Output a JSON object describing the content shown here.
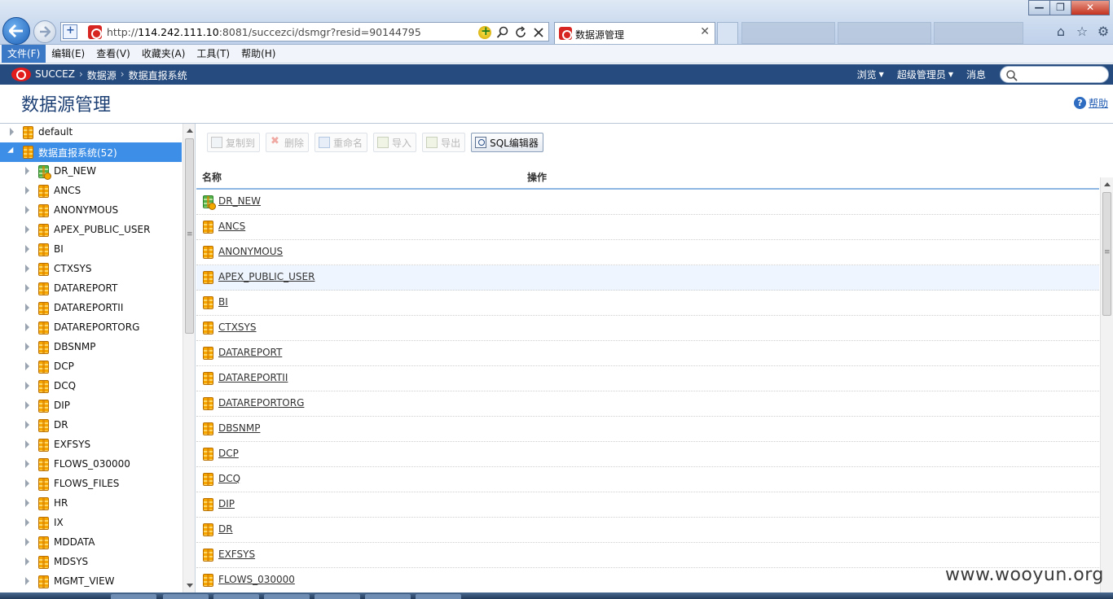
{
  "browser": {
    "url_prefix": "http://",
    "url_host": "114.242.111.10",
    "url_rest": ":8081/succezci/dsmgr?resid=90144795",
    "tab_title": "数据源管理",
    "tab_close": "✕",
    "window_controls": {
      "minimize": "—",
      "maximize": "❐",
      "close": "✕"
    }
  },
  "menubar": {
    "items": [
      {
        "label": "文件(F)"
      },
      {
        "label": "编辑(E)"
      },
      {
        "label": "查看(V)"
      },
      {
        "label": "收藏夹(A)"
      },
      {
        "label": "工具(T)"
      },
      {
        "label": "帮助(H)"
      }
    ]
  },
  "app_header": {
    "brand": "SUCCEZ",
    "crumb_1": "数据源",
    "crumb_2": "数据直报系统",
    "menu_browse": "浏览",
    "menu_admin": "超级管理员",
    "menu_messages": "消息",
    "search_placeholder": ""
  },
  "page": {
    "title": "数据源管理",
    "help_label": "帮助"
  },
  "tree": {
    "root": "default",
    "selected_group": "数据直报系统(52)",
    "children": [
      {
        "label": "DR_NEW",
        "icon": "green"
      },
      {
        "label": "ANCS",
        "icon": "orange"
      },
      {
        "label": "ANONYMOUS",
        "icon": "orange"
      },
      {
        "label": "APEX_PUBLIC_USER",
        "icon": "orange"
      },
      {
        "label": "BI",
        "icon": "orange"
      },
      {
        "label": "CTXSYS",
        "icon": "orange"
      },
      {
        "label": "DATAREPORT",
        "icon": "orange"
      },
      {
        "label": "DATAREPORTII",
        "icon": "orange"
      },
      {
        "label": "DATAREPORTORG",
        "icon": "orange"
      },
      {
        "label": "DBSNMP",
        "icon": "orange"
      },
      {
        "label": "DCP",
        "icon": "orange"
      },
      {
        "label": "DCQ",
        "icon": "orange"
      },
      {
        "label": "DIP",
        "icon": "orange"
      },
      {
        "label": "DR",
        "icon": "orange"
      },
      {
        "label": "EXFSYS",
        "icon": "orange"
      },
      {
        "label": "FLOWS_030000",
        "icon": "orange"
      },
      {
        "label": "FLOWS_FILES",
        "icon": "orange"
      },
      {
        "label": "HR",
        "icon": "orange"
      },
      {
        "label": "IX",
        "icon": "orange"
      },
      {
        "label": "MDDATA",
        "icon": "orange"
      },
      {
        "label": "MDSYS",
        "icon": "orange"
      },
      {
        "label": "MGMT_VIEW",
        "icon": "orange"
      }
    ]
  },
  "toolbar": {
    "copy": "复制到",
    "delete": "删除",
    "rename": "重命名",
    "import": "导入",
    "export": "导出",
    "sql_editor": "SQL编辑器"
  },
  "table": {
    "col_name": "名称",
    "col_action": "操作",
    "rows": [
      {
        "name": "DR_NEW",
        "icon": "green"
      },
      {
        "name": "ANCS",
        "icon": "orange"
      },
      {
        "name": "ANONYMOUS",
        "icon": "orange"
      },
      {
        "name": "APEX_PUBLIC_USER",
        "icon": "orange"
      },
      {
        "name": "BI",
        "icon": "orange"
      },
      {
        "name": "CTXSYS",
        "icon": "orange"
      },
      {
        "name": "DATAREPORT",
        "icon": "orange"
      },
      {
        "name": "DATAREPORTII",
        "icon": "orange"
      },
      {
        "name": "DATAREPORTORG",
        "icon": "orange"
      },
      {
        "name": "DBSNMP",
        "icon": "orange"
      },
      {
        "name": "DCP",
        "icon": "orange"
      },
      {
        "name": "DCQ",
        "icon": "orange"
      },
      {
        "name": "DIP",
        "icon": "orange"
      },
      {
        "name": "DR",
        "icon": "orange"
      },
      {
        "name": "EXFSYS",
        "icon": "orange"
      },
      {
        "name": "FLOWS_030000",
        "icon": "orange"
      }
    ]
  },
  "watermark": "www.wooyun.org",
  "colors": {
    "header_bg": "#264b7e",
    "selected_bg": "#3d8ee6",
    "title": "#1c3f74"
  }
}
